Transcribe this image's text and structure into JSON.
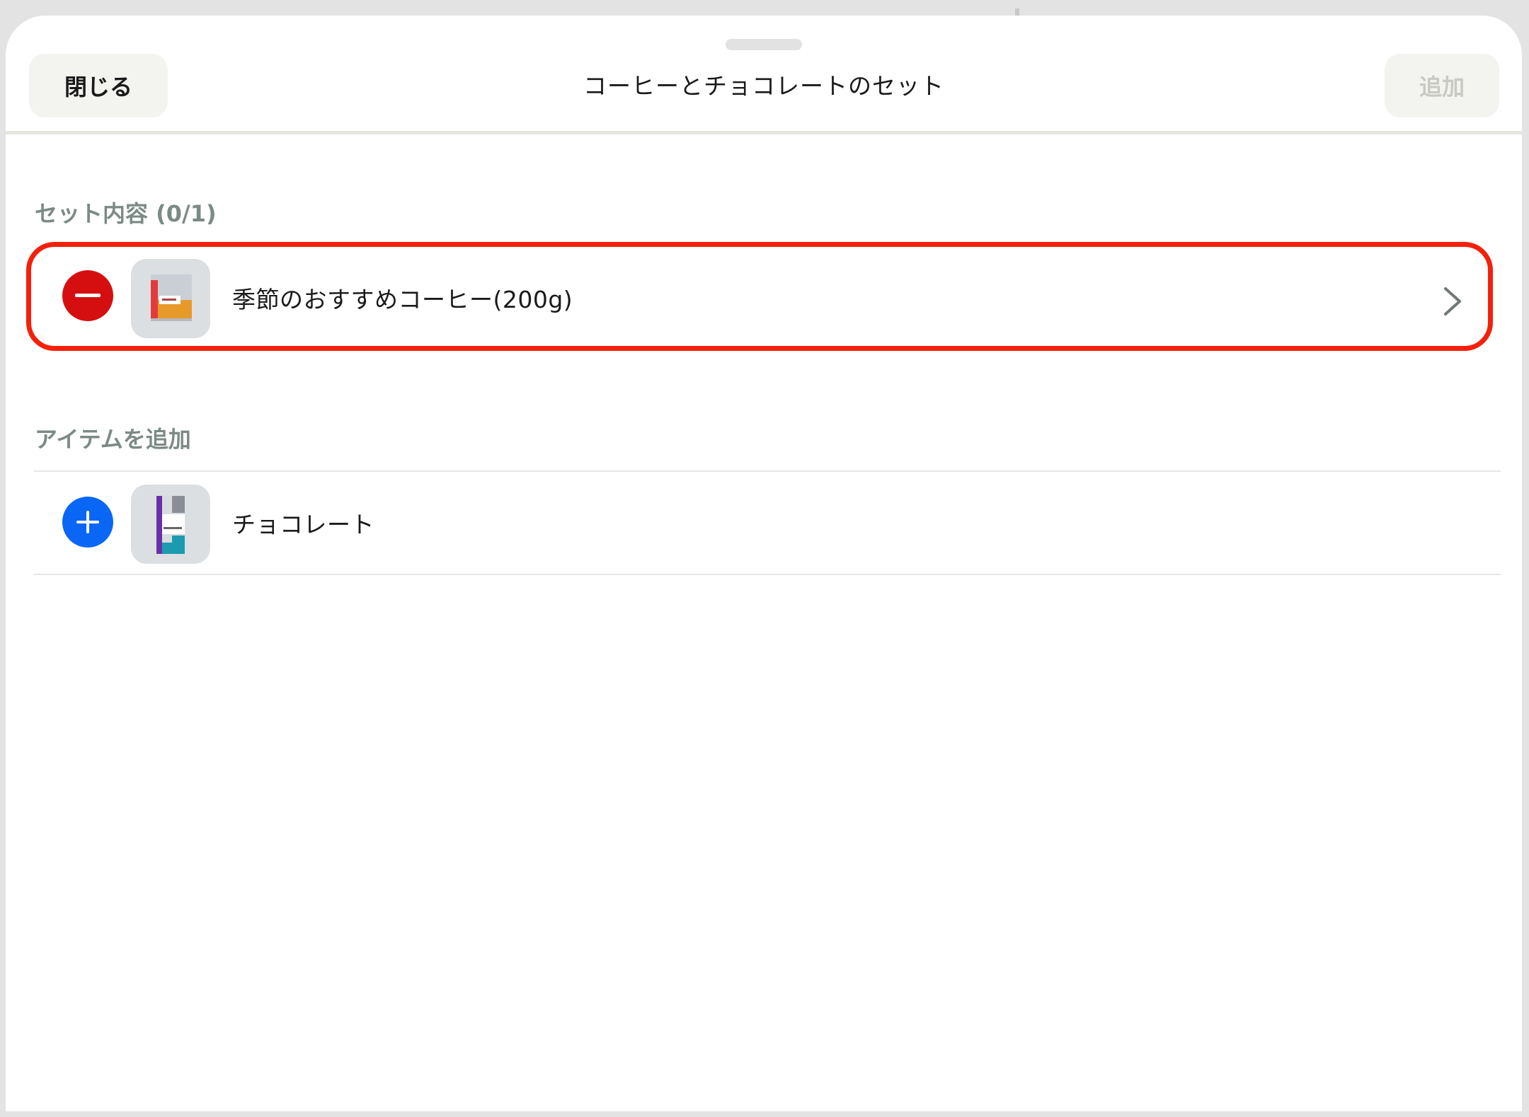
{
  "header": {
    "close_label": "閉じる",
    "title": "コーヒーとチョコレートのセット",
    "add_label": "追加"
  },
  "set_contents": {
    "section_label": "セット内容 (0/1)",
    "items": [
      {
        "name": "季節のおすすめコーヒー(200g)",
        "action_icon": "minus-circle-icon",
        "trailing_icon": "chevron-right-icon",
        "selected": true
      }
    ]
  },
  "add_items": {
    "section_label": "アイテムを追加",
    "items": [
      {
        "name": "チョコレート",
        "action_icon": "plus-circle-icon"
      }
    ]
  },
  "colors": {
    "remove": "#d50f0f",
    "add": "#0a66f5",
    "highlight": "#f3210b",
    "section_label": "#7c8a86",
    "disabled_text": "#c9c9c4"
  }
}
